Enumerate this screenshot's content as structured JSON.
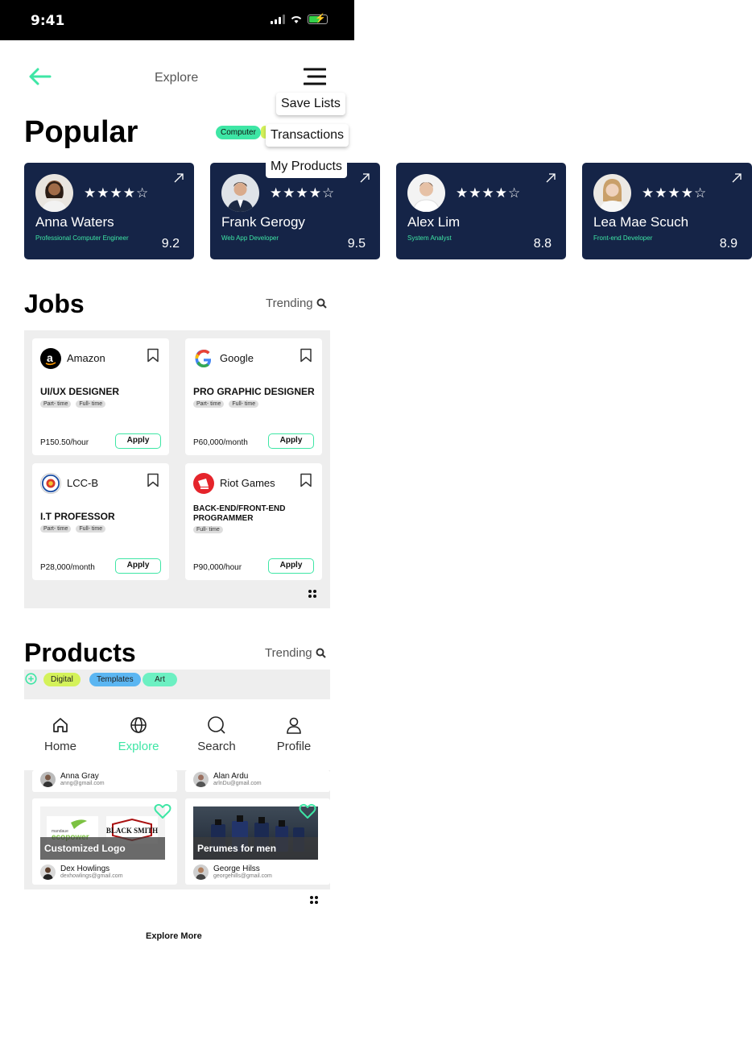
{
  "status_bar": {
    "time": "9:41"
  },
  "topbar": {
    "title": "Explore"
  },
  "menu": {
    "items": [
      "Save Lists",
      "Transactions",
      "My Products"
    ]
  },
  "popular": {
    "heading": "Popular",
    "chips": [
      "Computer"
    ],
    "cards": [
      {
        "name": "Anna Waters",
        "role": "Professional Computer Engineer",
        "score": "9.2",
        "stars": 4
      },
      {
        "name": "Frank Gerogy",
        "role": "Web  App Developer",
        "score": "9.5",
        "stars": 4
      },
      {
        "name": "Alex Lim",
        "role": "System Analyst",
        "score": "8.8",
        "stars": 4
      },
      {
        "name": "Lea Mae Scuch",
        "role": "Front-end Developer",
        "score": "8.9",
        "stars": 4
      }
    ]
  },
  "jobs": {
    "heading": "Jobs",
    "trending": "Trending",
    "cards": [
      {
        "company": "Amazon",
        "title": "UI/UX DESIGNER",
        "tags": [
          "Part- time",
          "Full- time"
        ],
        "pay": "P150.50/hour",
        "apply": "Apply"
      },
      {
        "company": "Google",
        "title": "PRO GRAPHIC DESIGNER",
        "tags": [
          "Part- time",
          "Full- time"
        ],
        "pay": "P60,000/month",
        "apply": "Apply"
      },
      {
        "company": "LCC-B",
        "title": "I.T PROFESSOR",
        "tags": [
          "Part- time",
          "Full- time"
        ],
        "pay": "P28,000/month",
        "apply": "Apply"
      },
      {
        "company": "Riot Games",
        "title": "BACK-END/FRONT-END PROGRAMMER",
        "tags": [
          "Full- time"
        ],
        "pay": "P90,000/hour",
        "apply": "Apply"
      }
    ]
  },
  "products": {
    "heading": "Products",
    "trending": "Trending",
    "filters": [
      "Digital",
      "Templates",
      "Art"
    ],
    "top_owners": [
      {
        "name": "Anna Gray",
        "email": "anng@gmail.com"
      },
      {
        "name": "Alan Ardu",
        "email": "arlnDu@gmail.com"
      }
    ],
    "items": [
      {
        "label": "Customized Logo",
        "owner": "Dex Howlings",
        "email": "dexhowlings@gmail.com",
        "logo_text_1": "ecopower",
        "logo_text_2": "BLACK SMITH"
      },
      {
        "label": "Perumes for men",
        "owner": "George Hilss",
        "email": "georgehills@gmail.com"
      }
    ],
    "explore_more": "Explore More"
  },
  "tabbar": {
    "tabs": [
      {
        "label": "Home",
        "active": false
      },
      {
        "label": "Explore",
        "active": true
      },
      {
        "label": "Search",
        "active": false
      },
      {
        "label": "Profile",
        "active": false
      }
    ]
  },
  "colors": {
    "accent": "#3ee6a5",
    "card_navy": "#152447",
    "panel_gray": "#eeeeee"
  }
}
